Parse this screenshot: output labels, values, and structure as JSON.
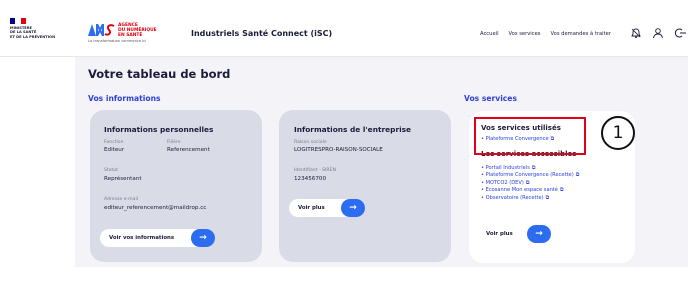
{
  "header": {
    "gov_lines": [
      "MINISTÈRE",
      "DE LA SANTÉ",
      "ET DE LA PRÉVENTION"
    ],
    "ans_lines": [
      "AGENCE",
      "DU NUMÉRIQUE",
      "EN SANTÉ"
    ],
    "ans_tagline": "La transformation commence ici",
    "app_name": "Industriels Santé Connect (iSC)",
    "nav": [
      "Accueil",
      "Vos services",
      "Vos demandes à traiter"
    ],
    "icons": [
      "notifications-icon",
      "user-icon",
      "logout-icon"
    ]
  },
  "page": {
    "title": "Votre tableau de bord",
    "info_section": "Vos informations",
    "services_section": "Vos services"
  },
  "personal": {
    "title": "Informations personnelles",
    "fields": [
      {
        "label": "Fonction",
        "value": "Editeur"
      },
      {
        "label": "Filière",
        "value": "Referencement"
      },
      {
        "label": "Statut",
        "value": "Représentant"
      },
      {
        "label": "Adresse e-mail",
        "value": "editeur_referencement@maildrop.cc"
      }
    ],
    "button": "Voir vos informations"
  },
  "company": {
    "title": "Informations de l'entreprise",
    "fields": [
      {
        "label": "Raison sociale",
        "value": "LOGITRESPRO-RAISON-SOCIALE"
      },
      {
        "label": "Identifiant - SIREN",
        "value": "123456700"
      }
    ],
    "button": "Voir plus"
  },
  "services": {
    "used_title": "Vos services utilisés",
    "used_items": [
      "Plateforme Convergence"
    ],
    "accessible_title": "Les services accessibles",
    "accessible_items": [
      "Portail Industriels",
      "Plateforme Convergence (Recette)",
      "MOTCO2 (DEV)",
      "Ecosanne Mon espace santé",
      "Observatoire (Recette)"
    ],
    "button": "Voir plus"
  },
  "annotation": {
    "number": "1"
  },
  "colors": {
    "accent": "#2c6cf0",
    "heading_blue": "#2d3fd8",
    "highlight_red": "#e1001a",
    "card_gray": "#d9dce6"
  }
}
